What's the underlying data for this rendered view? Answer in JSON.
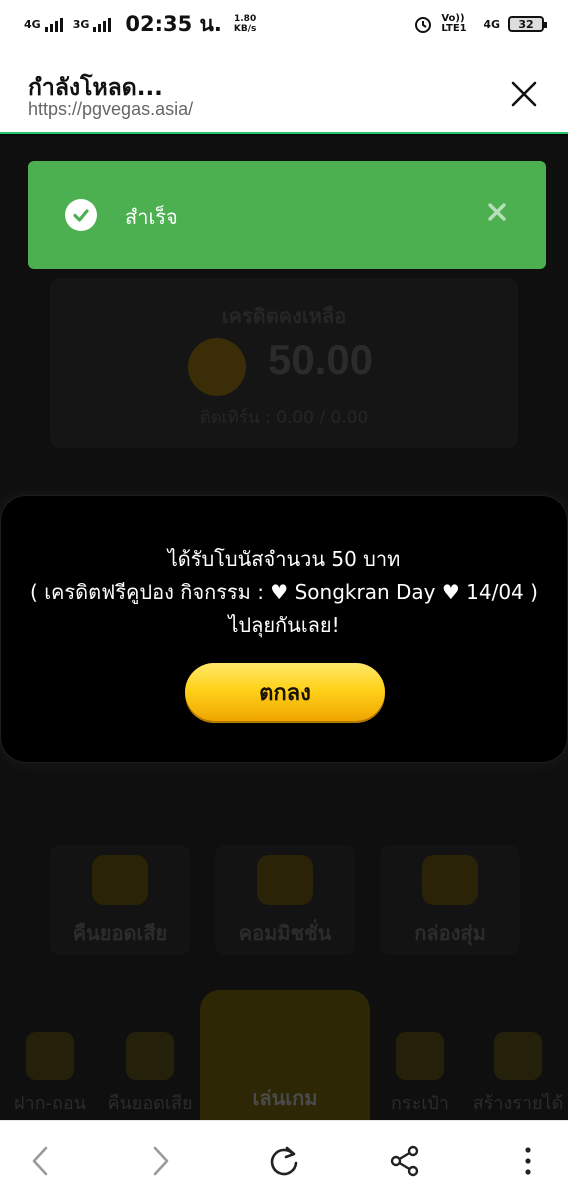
{
  "status_bar": {
    "network1": "4G",
    "network2": "3G",
    "time": "02:35 น.",
    "speed_value": "1.80",
    "speed_unit": "KB/s",
    "volte": "Vo)) LTE1",
    "network3": "4G",
    "battery": "32"
  },
  "browser": {
    "title": "กำลังโหลด...",
    "url": "https://pgvegas.asia/",
    "close_icon": "close-icon"
  },
  "toast": {
    "message": "สำเร็จ",
    "color": "#4caf50"
  },
  "background": {
    "credit_label": "เครดิตคงเหลือ",
    "credit_amount": "50.00",
    "turnover": "ติดเทิร์น : 0.00 / 0.00",
    "tiles": [
      "คืนยอดเสีย",
      "คอมมิชชั่น",
      "กล่องสุ่ม"
    ],
    "nav": {
      "deposit": "ฝาก-ถอน",
      "cashback": "คืนยอดเสีย",
      "play": "เล่นเกม",
      "wallet": "กระเป๋า",
      "referral": "สร้างรายได้"
    }
  },
  "modal": {
    "line1": "ได้รับโบนัสจำนวน 50 บาท",
    "line2": "( เครดิตฟรีคูปอง กิจกรรม : ♥ Songkran Day ♥ 14/04 )",
    "line3": "ไปลุยกันเลย!",
    "ok_button": "ตกลง"
  },
  "browser_nav": {
    "icons": [
      "back-icon",
      "forward-icon",
      "reload-icon",
      "share-icon",
      "more-icon"
    ]
  }
}
